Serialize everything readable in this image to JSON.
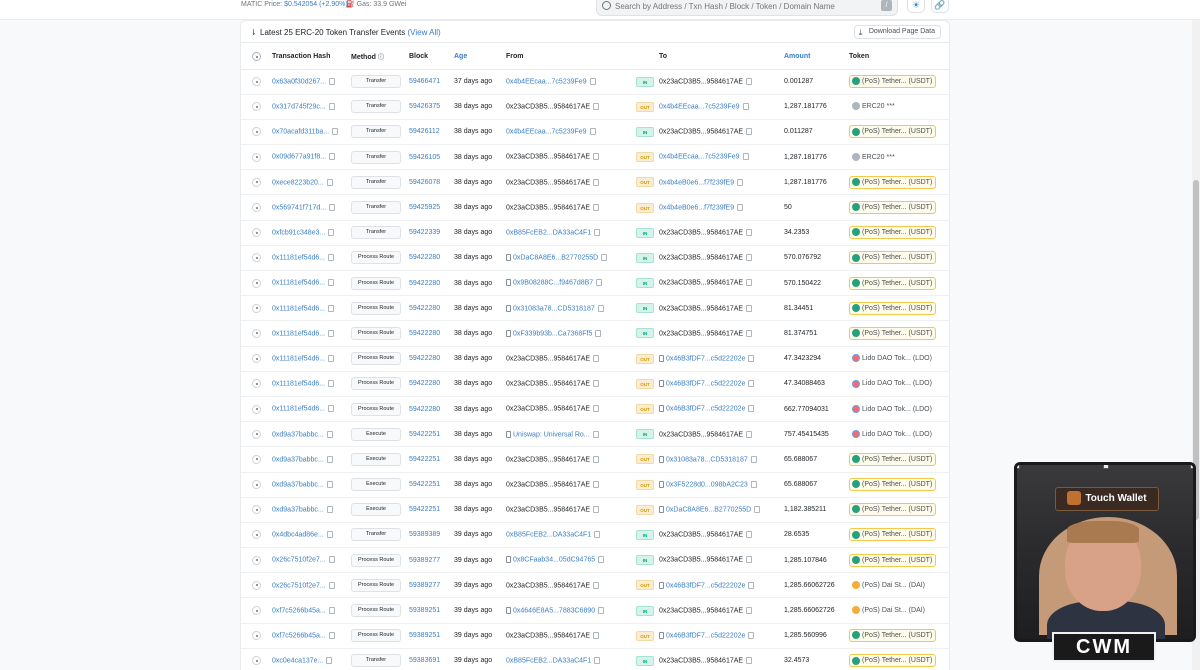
{
  "header": {
    "matic_price_label": "MATIC Price:",
    "matic_price_value": "$0.542054 (+2.90%)",
    "gas": "Gas: 33.9 GWei",
    "search_placeholder": "Search by Address / Txn Hash / Block / Token / Domain Name",
    "search_shortcut": "/"
  },
  "card": {
    "title": "Latest 25 ERC-20 Token Transfer Events",
    "view_all": "(View All)",
    "download": "Download Page Data"
  },
  "columns": {
    "hash": "Transaction Hash",
    "method": "Method",
    "block": "Block",
    "age": "Age",
    "from": "From",
    "to": "To",
    "amount": "Amount",
    "token": "Token"
  },
  "rows": [
    {
      "hash": "0x63a0f30d267...",
      "method": "Transfer",
      "block": "59466471",
      "age": "37 days ago",
      "from": "0x4b4EEcaa...7c5239Fe9",
      "from_link": true,
      "from_doc": false,
      "dir": "IN",
      "to": "0x23aCD3B5...9584617AE",
      "to_link": false,
      "to_doc": false,
      "amount": "0.001287",
      "token": "(PoS) Tether... (USDT)",
      "token_type": "usdt"
    },
    {
      "hash": "0x317d745f29c...",
      "method": "Transfer",
      "block": "59426375",
      "age": "38 days ago",
      "from": "0x23aCD3B5...9584617AE",
      "from_link": false,
      "from_doc": false,
      "dir": "OUT",
      "to": "0x4b4EEcaa...7c5239Fe9",
      "to_link": true,
      "to_doc": false,
      "amount": "1,287.181776",
      "token": "ERC20 ***",
      "token_type": "erc"
    },
    {
      "hash": "0x70acafd311ba...",
      "method": "Transfer",
      "block": "59426112",
      "age": "38 days ago",
      "from": "0x4b4EEcaa...7c5239Fe9",
      "from_link": true,
      "from_doc": false,
      "dir": "IN",
      "to": "0x23aCD3B5...9584617AE",
      "to_link": false,
      "to_doc": false,
      "amount": "0.011287",
      "token": "(PoS) Tether... (USDT)",
      "token_type": "usdt"
    },
    {
      "hash": "0x09d677a91f8...",
      "method": "Transfer",
      "block": "59426105",
      "age": "38 days ago",
      "from": "0x23aCD3B5...9584617AE",
      "from_link": false,
      "from_doc": false,
      "dir": "OUT",
      "to": "0x4b4EEcaa...7c5239Fe9",
      "to_link": true,
      "to_doc": false,
      "amount": "1,287.181776",
      "token": "ERC20 ***",
      "token_type": "erc"
    },
    {
      "hash": "0xece8223b20...",
      "method": "Transfer",
      "block": "59426078",
      "age": "38 days ago",
      "from": "0x23aCD3B5...9584617AE",
      "from_link": false,
      "from_doc": false,
      "dir": "OUT",
      "to": "0x4b4eB0e6...f7f239fE9",
      "to_link": true,
      "to_doc": false,
      "amount": "1,287.181776",
      "token": "(PoS) Tether... (USDT)",
      "token_type": "usdt"
    },
    {
      "hash": "0x569741f717d...",
      "method": "Transfer",
      "block": "59425925",
      "age": "38 days ago",
      "from": "0x23aCD3B5...9584617AE",
      "from_link": false,
      "from_doc": false,
      "dir": "OUT",
      "to": "0x4b4eB0e6...f7f239fE9",
      "to_link": true,
      "to_doc": false,
      "amount": "50",
      "token": "(PoS) Tether... (USDT)",
      "token_type": "usdt"
    },
    {
      "hash": "0xfcb91c348e3...",
      "method": "Transfer",
      "block": "59422339",
      "age": "38 days ago",
      "from": "0xB85FcEB2...DA33aC4F1",
      "from_link": true,
      "from_doc": false,
      "dir": "IN",
      "to": "0x23aCD3B5...9584617AE",
      "to_link": false,
      "to_doc": false,
      "amount": "34.2353",
      "token": "(PoS) Tether... (USDT)",
      "token_type": "usdt"
    },
    {
      "hash": "0x11181ef54d6...",
      "method": "Process Route",
      "block": "59422280",
      "age": "38 days ago",
      "from": "0xDaC8A8E6...B2770255D",
      "from_link": true,
      "from_doc": true,
      "dir": "IN",
      "to": "0x23aCD3B5...9584617AE",
      "to_link": false,
      "to_doc": false,
      "amount": "570.076792",
      "token": "(PoS) Tether... (USDT)",
      "token_type": "usdt"
    },
    {
      "hash": "0x11181ef54d6...",
      "method": "Process Route",
      "block": "59422280",
      "age": "38 days ago",
      "from": "0x9B08288C...f9467d8B7",
      "from_link": true,
      "from_doc": true,
      "dir": "IN",
      "to": "0x23aCD3B5...9584617AE",
      "to_link": false,
      "to_doc": false,
      "amount": "570.150422",
      "token": "(PoS) Tether... (USDT)",
      "token_type": "usdt"
    },
    {
      "hash": "0x11181ef54d6...",
      "method": "Process Route",
      "block": "59422280",
      "age": "38 days ago",
      "from": "0x31083a78...CD5318187",
      "from_link": true,
      "from_doc": true,
      "dir": "IN",
      "to": "0x23aCD3B5...9584617AE",
      "to_link": false,
      "to_doc": false,
      "amount": "81.34451",
      "token": "(PoS) Tether... (USDT)",
      "token_type": "usdt"
    },
    {
      "hash": "0x11181ef54d6...",
      "method": "Process Route",
      "block": "59422280",
      "age": "38 days ago",
      "from": "0xF339b93b...Ca7368Ff5",
      "from_link": true,
      "from_doc": true,
      "dir": "IN",
      "to": "0x23aCD3B5...9584617AE",
      "to_link": false,
      "to_doc": false,
      "amount": "81.374751",
      "token": "(PoS) Tether... (USDT)",
      "token_type": "usdt"
    },
    {
      "hash": "0x11181ef54d6...",
      "method": "Process Route",
      "block": "59422280",
      "age": "38 days ago",
      "from": "0x23aCD3B5...9584617AE",
      "from_link": false,
      "from_doc": false,
      "dir": "OUT",
      "to": "0x46B3fDF7...c5d22202e",
      "to_link": true,
      "to_doc": true,
      "amount": "47.3423294",
      "token": "Lido DAO Tok... (LDO)",
      "token_type": "ldo"
    },
    {
      "hash": "0x11181ef54d6...",
      "method": "Process Route",
      "block": "59422280",
      "age": "38 days ago",
      "from": "0x23aCD3B5...9584617AE",
      "from_link": false,
      "from_doc": false,
      "dir": "OUT",
      "to": "0x46B3fDF7...c5d22202e",
      "to_link": true,
      "to_doc": true,
      "amount": "47.34088463",
      "token": "Lido DAO Tok... (LDO)",
      "token_type": "ldo"
    },
    {
      "hash": "0x11181ef54d6...",
      "method": "Process Route",
      "block": "59422280",
      "age": "38 days ago",
      "from": "0x23aCD3B5...9584617AE",
      "from_link": false,
      "from_doc": false,
      "dir": "OUT",
      "to": "0x46B3fDF7...c5d22202e",
      "to_link": true,
      "to_doc": true,
      "amount": "662.77094031",
      "token": "Lido DAO Tok... (LDO)",
      "token_type": "ldo"
    },
    {
      "hash": "0xd9a37babbc...",
      "method": "Execute",
      "block": "59422251",
      "age": "38 days ago",
      "from": "Uniswap: Universal Ro...",
      "from_link": true,
      "from_doc": true,
      "dir": "IN",
      "to": "0x23aCD3B5...9584617AE",
      "to_link": false,
      "to_doc": false,
      "amount": "757.45415435",
      "token": "Lido DAO Tok... (LDO)",
      "token_type": "ldo"
    },
    {
      "hash": "0xd9a37babbc...",
      "method": "Execute",
      "block": "59422251",
      "age": "38 days ago",
      "from": "0x23aCD3B5...9584617AE",
      "from_link": false,
      "from_doc": false,
      "dir": "OUT",
      "to": "0x31083a78...CD5318187",
      "to_link": true,
      "to_doc": true,
      "amount": "65.688067",
      "token": "(PoS) Tether... (USDT)",
      "token_type": "usdt"
    },
    {
      "hash": "0xd9a37babbc...",
      "method": "Execute",
      "block": "59422251",
      "age": "38 days ago",
      "from": "0x23aCD3B5...9584617AE",
      "from_link": false,
      "from_doc": false,
      "dir": "OUT",
      "to": "0x3F5228d0...098bA2C23",
      "to_link": true,
      "to_doc": true,
      "amount": "65.688067",
      "token": "(PoS) Tether... (USDT)",
      "token_type": "usdt"
    },
    {
      "hash": "0xd9a37babbc...",
      "method": "Execute",
      "block": "59422251",
      "age": "38 days ago",
      "from": "0x23aCD3B5...9584617AE",
      "from_link": false,
      "from_doc": false,
      "dir": "OUT",
      "to": "0xDaC8A8E6...B2770255D",
      "to_link": true,
      "to_doc": true,
      "amount": "1,182.385211",
      "token": "(PoS) Tether... (USDT)",
      "token_type": "usdt"
    },
    {
      "hash": "0x4dbc4ad86e...",
      "method": "Transfer",
      "block": "59389389",
      "age": "39 days ago",
      "from": "0xB85FcEB2...DA33aC4F1",
      "from_link": true,
      "from_doc": false,
      "dir": "IN",
      "to": "0x23aCD3B5...9584617AE",
      "to_link": false,
      "to_doc": false,
      "amount": "28.6535",
      "token": "(PoS) Tether... (USDT)",
      "token_type": "usdt"
    },
    {
      "hash": "0x26c7510f2e7...",
      "method": "Process Route",
      "block": "59389277",
      "age": "39 days ago",
      "from": "0x8CFaab34...05dC94765",
      "from_link": true,
      "from_doc": true,
      "dir": "IN",
      "to": "0x23aCD3B5...9584617AE",
      "to_link": false,
      "to_doc": false,
      "amount": "1,285.107846",
      "token": "(PoS) Tether... (USDT)",
      "token_type": "usdt"
    },
    {
      "hash": "0x26c7510f2e7...",
      "method": "Process Route",
      "block": "59389277",
      "age": "39 days ago",
      "from": "0x23aCD3B5...9584617AE",
      "from_link": false,
      "from_doc": false,
      "dir": "OUT",
      "to": "0x46B3fDF7...c5d22202e",
      "to_link": true,
      "to_doc": true,
      "amount": "1,285.66062726",
      "token": "(PoS) Dai St... (DAI)",
      "token_type": "dai"
    },
    {
      "hash": "0xf7c5266b45a...",
      "method": "Process Route",
      "block": "59389251",
      "age": "39 days ago",
      "from": "0x4646E8A5...7883C6890",
      "from_link": true,
      "from_doc": true,
      "dir": "IN",
      "to": "0x23aCD3B5...9584617AE",
      "to_link": false,
      "to_doc": false,
      "amount": "1,285.66062726",
      "token": "(PoS) Dai St... (DAI)",
      "token_type": "dai"
    },
    {
      "hash": "0xf7c5266b45a...",
      "method": "Process Route",
      "block": "59389251",
      "age": "39 days ago",
      "from": "0x23aCD3B5...9584617AE",
      "from_link": false,
      "from_doc": false,
      "dir": "OUT",
      "to": "0x46B3fDF7...c5d22202e",
      "to_link": true,
      "to_doc": true,
      "amount": "1,285.560996",
      "token": "(PoS) Tether... (USDT)",
      "token_type": "usdt"
    },
    {
      "hash": "0xc0e4ca137e...",
      "method": "Transfer",
      "block": "59383691",
      "age": "39 days ago",
      "from": "0xB85FcEB2...DA33aC4F1",
      "from_link": true,
      "from_doc": false,
      "dir": "IN",
      "to": "0x23aCD3B5...9584617AE",
      "to_link": false,
      "to_doc": false,
      "amount": "32.4573",
      "token": "(PoS) Tether... (USDT)",
      "token_type": "usdt"
    }
  ],
  "overlay": {
    "brand": "Touch Wallet",
    "logo": "CWM"
  },
  "colors": {
    "link": "#3a7ec4",
    "in_badge": "#00a186",
    "out_badge": "#cc9a06",
    "usdt": "#26a17b"
  }
}
